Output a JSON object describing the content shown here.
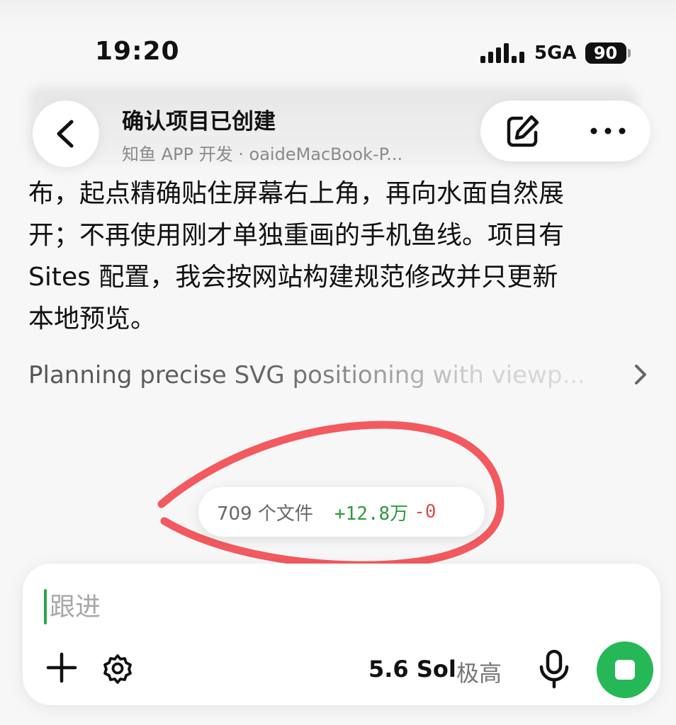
{
  "status": {
    "time": "19:20",
    "network": "5GA",
    "battery": "90"
  },
  "header": {
    "title": "确认项目已创建",
    "subtitle": "知鱼 APP 开发 · oaideMacBook-P..."
  },
  "message": {
    "lines": [
      "布，起点精确贴住屏幕右上角，再向水面自然展",
      "开；不再使用刚才单独重画的手机鱼线。项目有",
      "Sites 配置，我会按网站构建规范修改并只更新",
      "本地预览。"
    ]
  },
  "reasoning": {
    "text": "Planning precise SVG positioning with viewp..."
  },
  "changes": {
    "files": "709 个文件",
    "added": "+12.8万",
    "removed": "-0"
  },
  "composer": {
    "placeholder": "跟进",
    "model": "5.6 Sol",
    "effort": "极高"
  },
  "colors": {
    "accent_green": "#26b857",
    "annotation_red": "#f25a5f",
    "added_green": "#2c9a3c",
    "removed_red": "#d4504f"
  },
  "icons": {
    "back": "chevron-left-icon",
    "edit": "compose-icon",
    "more": "more-icon",
    "reasoning": "chevron-right-icon",
    "add": "plus-icon",
    "settings": "gear-icon",
    "mic": "microphone-icon",
    "stop": "stop-icon"
  }
}
